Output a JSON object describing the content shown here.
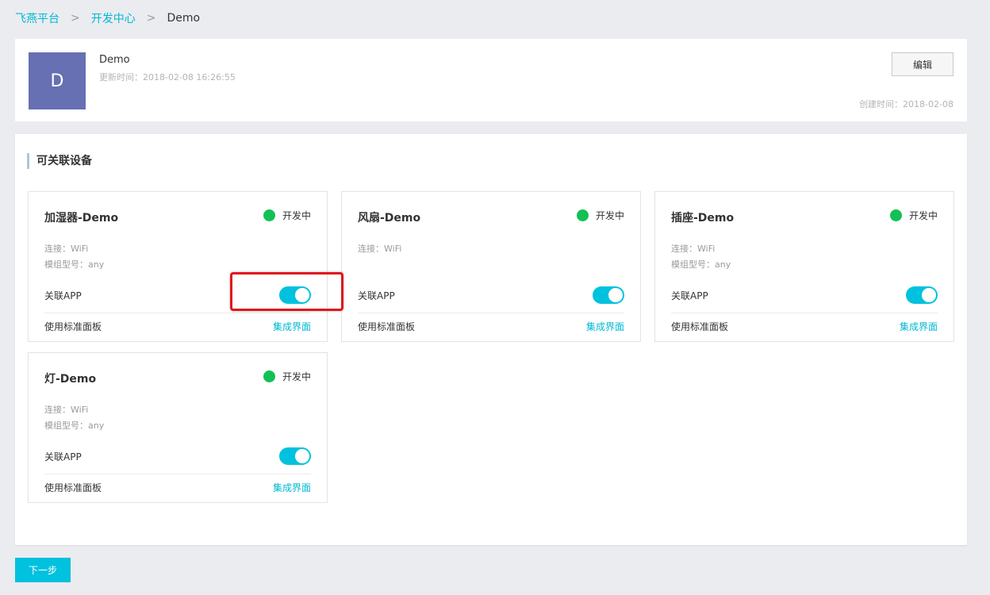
{
  "breadcrumb": {
    "items": [
      "飞燕平台",
      "开发中心",
      "Demo"
    ],
    "separator": ">"
  },
  "project": {
    "avatar_letter": "D",
    "name": "Demo",
    "updated": "更新时间：2018-02-08 16:26:55",
    "edit_label": "编辑",
    "created": "创建时间：2018-02-08",
    "avatar_color": "#6670b3"
  },
  "devices_section": {
    "title": "可关联设备",
    "devices": [
      {
        "name": "加湿器-Demo",
        "status": "开发中",
        "connection": "连接：WiFi",
        "model": "模组型号：any",
        "link_app_label": "关联APP",
        "link_app_on": true,
        "panel_label": "使用标准面板",
        "integrate_label": "集成界面"
      },
      {
        "name": "风扇-Demo",
        "status": "开发中",
        "connection": "连接：WiFi",
        "model": "",
        "link_app_label": "关联APP",
        "link_app_on": true,
        "panel_label": "使用标准面板",
        "integrate_label": "集成界面"
      },
      {
        "name": "插座-Demo",
        "status": "开发中",
        "connection": "连接：WiFi",
        "model": "模组型号：any",
        "link_app_label": "关联APP",
        "link_app_on": true,
        "panel_label": "使用标准面板",
        "integrate_label": "集成界面"
      },
      {
        "name": "灯-Demo",
        "status": "开发中",
        "connection": "连接：WiFi",
        "model": "模组型号：any",
        "link_app_label": "关联APP",
        "link_app_on": true,
        "panel_label": "使用标准面板",
        "integrate_label": "集成界面"
      }
    ]
  },
  "footer": {
    "next_label": "下一步"
  },
  "colors": {
    "accent": "#00c1de",
    "link": "#00b8d4",
    "status_green": "#14c055",
    "highlight_red": "#e0141e",
    "background": "#ebecf0"
  }
}
